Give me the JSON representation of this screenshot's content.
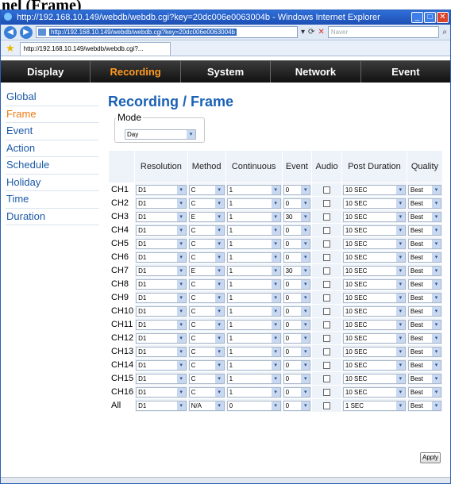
{
  "doc_title": "nel (Frame)",
  "window": {
    "title": "http://192.168.10.149/webdb/webdb.cgi?key=20dc006e0063004b - Windows Internet Explorer",
    "address": "http://192.168.10.149/webdb/webdb.cgi?key=20dc006e0063004b",
    "search_placeholder": "Naver",
    "tab_title": "http://192.168.10.149/webdb/webdb.cgi?..."
  },
  "menu": [
    {
      "label": "Display",
      "active": false
    },
    {
      "label": "Recording",
      "active": true
    },
    {
      "label": "System",
      "active": false
    },
    {
      "label": "Network",
      "active": false
    },
    {
      "label": "Event",
      "active": false
    }
  ],
  "sidebar": [
    {
      "label": "Global",
      "active": false
    },
    {
      "label": "Frame",
      "active": true
    },
    {
      "label": "Event",
      "active": false
    },
    {
      "label": "Action",
      "active": false
    },
    {
      "label": "Schedule",
      "active": false
    },
    {
      "label": "Holiday",
      "active": false
    },
    {
      "label": "Time",
      "active": false
    },
    {
      "label": "Duration",
      "active": false
    }
  ],
  "page_title": "Recording / Frame",
  "mode": {
    "label": "Mode",
    "value": "Day"
  },
  "table": {
    "headers": [
      "Resolution",
      "Method",
      "Continuous",
      "Event",
      "Audio",
      "Post Duration",
      "Quality"
    ],
    "rows": [
      {
        "ch": "CH1",
        "resolution": "D1",
        "method": "C",
        "continuous": "1",
        "event": "0",
        "post": "10 SEC",
        "quality": "Best"
      },
      {
        "ch": "CH2",
        "resolution": "D1",
        "method": "C",
        "continuous": "1",
        "event": "0",
        "post": "10 SEC",
        "quality": "Best"
      },
      {
        "ch": "CH3",
        "resolution": "D1",
        "method": "E",
        "continuous": "1",
        "event": "30",
        "post": "10 SEC",
        "quality": "Best"
      },
      {
        "ch": "CH4",
        "resolution": "D1",
        "method": "C",
        "continuous": "1",
        "event": "0",
        "post": "10 SEC",
        "quality": "Best"
      },
      {
        "ch": "CH5",
        "resolution": "D1",
        "method": "C",
        "continuous": "1",
        "event": "0",
        "post": "10 SEC",
        "quality": "Best"
      },
      {
        "ch": "CH6",
        "resolution": "D1",
        "method": "C",
        "continuous": "1",
        "event": "0",
        "post": "10 SEC",
        "quality": "Best"
      },
      {
        "ch": "CH7",
        "resolution": "D1",
        "method": "E",
        "continuous": "1",
        "event": "30",
        "post": "10 SEC",
        "quality": "Best"
      },
      {
        "ch": "CH8",
        "resolution": "D1",
        "method": "C",
        "continuous": "1",
        "event": "0",
        "post": "10 SEC",
        "quality": "Best"
      },
      {
        "ch": "CH9",
        "resolution": "D1",
        "method": "C",
        "continuous": "1",
        "event": "0",
        "post": "10 SEC",
        "quality": "Best"
      },
      {
        "ch": "CH10",
        "resolution": "D1",
        "method": "C",
        "continuous": "1",
        "event": "0",
        "post": "10 SEC",
        "quality": "Best"
      },
      {
        "ch": "CH11",
        "resolution": "D1",
        "method": "C",
        "continuous": "1",
        "event": "0",
        "post": "10 SEC",
        "quality": "Best"
      },
      {
        "ch": "CH12",
        "resolution": "D1",
        "method": "C",
        "continuous": "1",
        "event": "0",
        "post": "10 SEC",
        "quality": "Best"
      },
      {
        "ch": "CH13",
        "resolution": "D1",
        "method": "C",
        "continuous": "1",
        "event": "0",
        "post": "10 SEC",
        "quality": "Best"
      },
      {
        "ch": "CH14",
        "resolution": "D1",
        "method": "C",
        "continuous": "1",
        "event": "0",
        "post": "10 SEC",
        "quality": "Best"
      },
      {
        "ch": "CH15",
        "resolution": "D1",
        "method": "C",
        "continuous": "1",
        "event": "0",
        "post": "10 SEC",
        "quality": "Best"
      },
      {
        "ch": "CH16",
        "resolution": "D1",
        "method": "C",
        "continuous": "1",
        "event": "0",
        "post": "10 SEC",
        "quality": "Best"
      },
      {
        "ch": "All",
        "resolution": "D1",
        "method": "N/A",
        "continuous": "0",
        "event": "0",
        "post": "1 SEC",
        "quality": "Best"
      }
    ]
  },
  "apply_label": "Apply"
}
